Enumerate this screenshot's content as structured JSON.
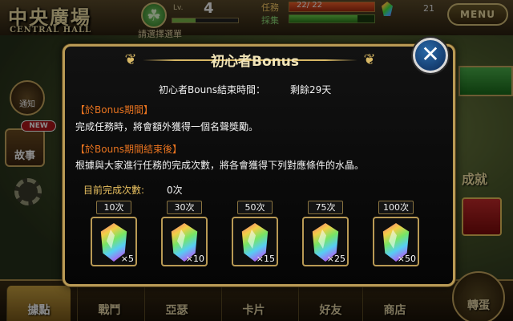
{
  "hud": {
    "hall_title_zh": "中央廣場",
    "hall_title_en": "CENTRAL HALL",
    "level_label": "Lv.",
    "level_value": "4",
    "level_progress": 0.35,
    "subtitle": "請選擇選單",
    "task_label": "任務",
    "task_count": "22/ 22",
    "task_progress": 1.0,
    "collect_label": "採集",
    "collect_progress": 0.8,
    "gem_count": "21",
    "menu_label": "MENU"
  },
  "side": {
    "notice_label": "通知",
    "new_badge": "NEW",
    "story_label": "故事",
    "achievement_label": "成就"
  },
  "tabs": [
    {
      "label": "據點"
    },
    {
      "label": "戰鬥"
    },
    {
      "label": "亞瑟"
    },
    {
      "label": "卡片"
    },
    {
      "label": "好友"
    },
    {
      "label": "商店"
    },
    {
      "label": "轉蛋"
    }
  ],
  "dialog": {
    "title": "初心者Bonus",
    "close_symbol": "✕",
    "end_time_label": "初心者Bouns結束時間：",
    "end_time_value": "剩餘29天",
    "section1_head": "【於Bonus期間】",
    "section1_text": "完成任務時，將會額外獲得一個名聲獎勵。",
    "section2_head": "【於Bouns期間結束後】",
    "section2_text": "根據與大家進行任務的完成次數，將各會獲得下列對應條件的水晶。",
    "count_label": "目前完成次數:",
    "count_value": "0次",
    "rewards": [
      {
        "threshold": "10次",
        "qty": "×5"
      },
      {
        "threshold": "30次",
        "qty": "×10"
      },
      {
        "threshold": "50次",
        "qty": "×15"
      },
      {
        "threshold": "75次",
        "qty": "×25"
      },
      {
        "threshold": "100次",
        "qty": "×50"
      }
    ]
  }
}
